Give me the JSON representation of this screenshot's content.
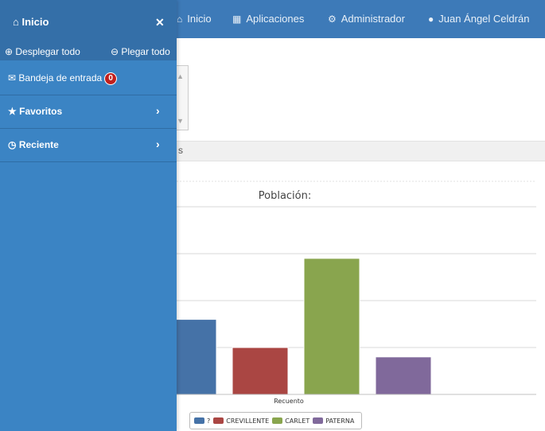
{
  "navbar": {
    "items": [
      {
        "label": "Inicio",
        "icon": "home-icon"
      },
      {
        "label": "Aplicaciones",
        "icon": "grid-icon"
      },
      {
        "label": "Administrador",
        "icon": "cogs-icon"
      },
      {
        "label": "Juan Ángel Celdrán",
        "icon": "user-icon"
      }
    ]
  },
  "sidebar": {
    "title": "Inicio",
    "expand_all": "Desplegar todo",
    "collapse_all": "Plegar todo",
    "items": [
      {
        "label": "Bandeja de entrada",
        "badge": "0",
        "icon": "envelope-icon"
      },
      {
        "label": "Favoritos",
        "icon": "star-icon"
      },
      {
        "label": "Reciente",
        "icon": "clock-icon"
      }
    ]
  },
  "section": {
    "text": "s"
  },
  "chart_data": {
    "type": "bar",
    "title": "Población:",
    "xlabel": "Recuento",
    "ylabel": "",
    "categories": [
      "?",
      "CREVILLENTE",
      "CARLET",
      "PATERNA"
    ],
    "values": [
      16,
      10,
      29,
      8
    ],
    "ylim": [
      0,
      40
    ],
    "grid": true,
    "legend": "bottom",
    "colors": [
      "#4572a7",
      "#aa4643",
      "#89a54e",
      "#80699b"
    ]
  }
}
